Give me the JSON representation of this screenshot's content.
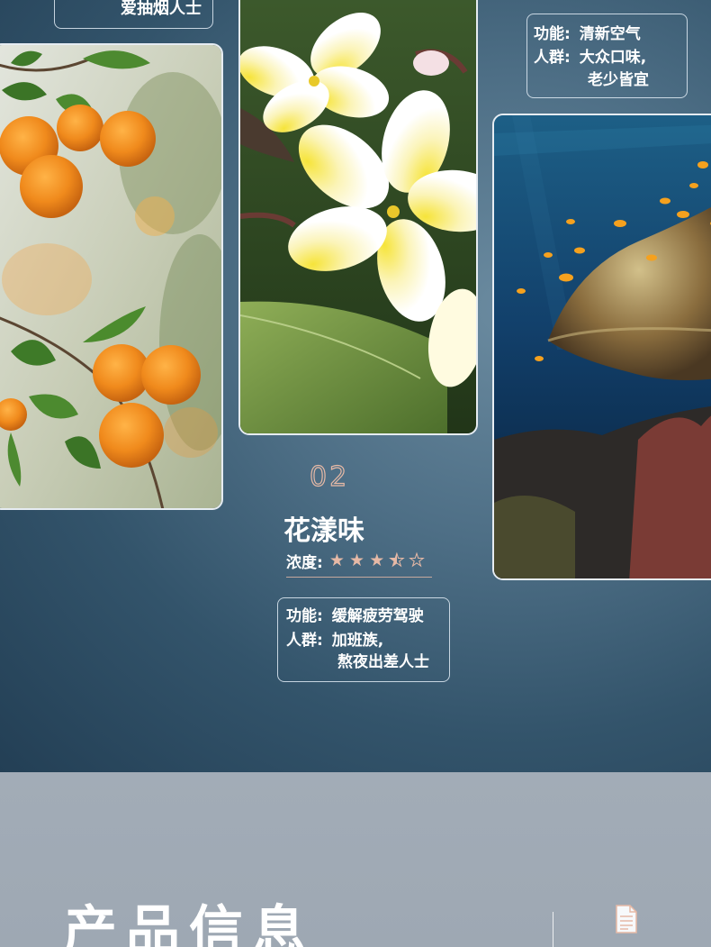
{
  "items": {
    "left_box": {
      "partial_line": "爱抽烟人士"
    },
    "middle": {
      "number": "02",
      "name": "花漾味",
      "concentration_label": "浓度:",
      "rating": 3.5,
      "rating_max": 5,
      "function_label": "功能:",
      "function_value": "缓解疲劳驾驶",
      "crowd_label": "人群:",
      "crowd_value_line1": "加班族,",
      "crowd_value_line2": "熬夜出差人士"
    },
    "right_box": {
      "function_label": "功能:",
      "function_value": "清新空气",
      "crowd_label": "人群:",
      "crowd_value_line1": "大众口味,",
      "crowd_value_line2": "老少皆宜"
    }
  },
  "section": {
    "title": "产品信息"
  },
  "icons": [
    "orange-tree-photo",
    "frangipani-flower-photo",
    "coral-reef-photo",
    "document-icon",
    "star-icon"
  ],
  "colors": {
    "accent": "#e6b9a6",
    "border": "#e6ecf2",
    "bottom_bg": "#a1abb6"
  }
}
